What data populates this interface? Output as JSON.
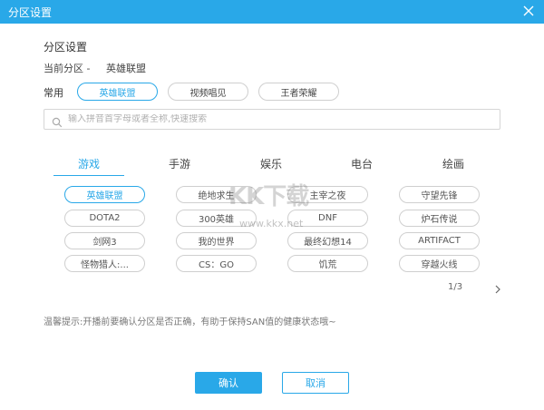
{
  "window": {
    "title": "分区设置"
  },
  "section": {
    "title": "分区设置"
  },
  "current": {
    "label": "当前分区 -",
    "value": "英雄联盟"
  },
  "common": {
    "label": "常用",
    "chips": [
      "英雄联盟",
      "视频唱见",
      "王者荣耀"
    ]
  },
  "search": {
    "placeholder": "输入拼音首字母或者全称,快速搜索"
  },
  "tabs": [
    "游戏",
    "手游",
    "娱乐",
    "电台",
    "绘画"
  ],
  "games": [
    "英雄联盟",
    "绝地求生",
    "主宰之夜",
    "守望先锋",
    "DOTA2",
    "300英雄",
    "DNF",
    "炉石传说",
    "剑网3",
    "我的世界",
    "最终幻想14",
    "ARTIFACT",
    "怪物猎人:...",
    "CS：GO",
    "饥荒",
    "穿越火线"
  ],
  "pager": {
    "text": "1/3"
  },
  "hint": "温馨提示:开播前要确认分区是否正确，有助于保持SAN值的健康状态哦~",
  "watermark": {
    "logo": "KK下载",
    "url": "www.kkx.net"
  },
  "buttons": {
    "confirm": "确认",
    "cancel": "取消"
  },
  "colors": {
    "accent": "#29a8e8"
  }
}
